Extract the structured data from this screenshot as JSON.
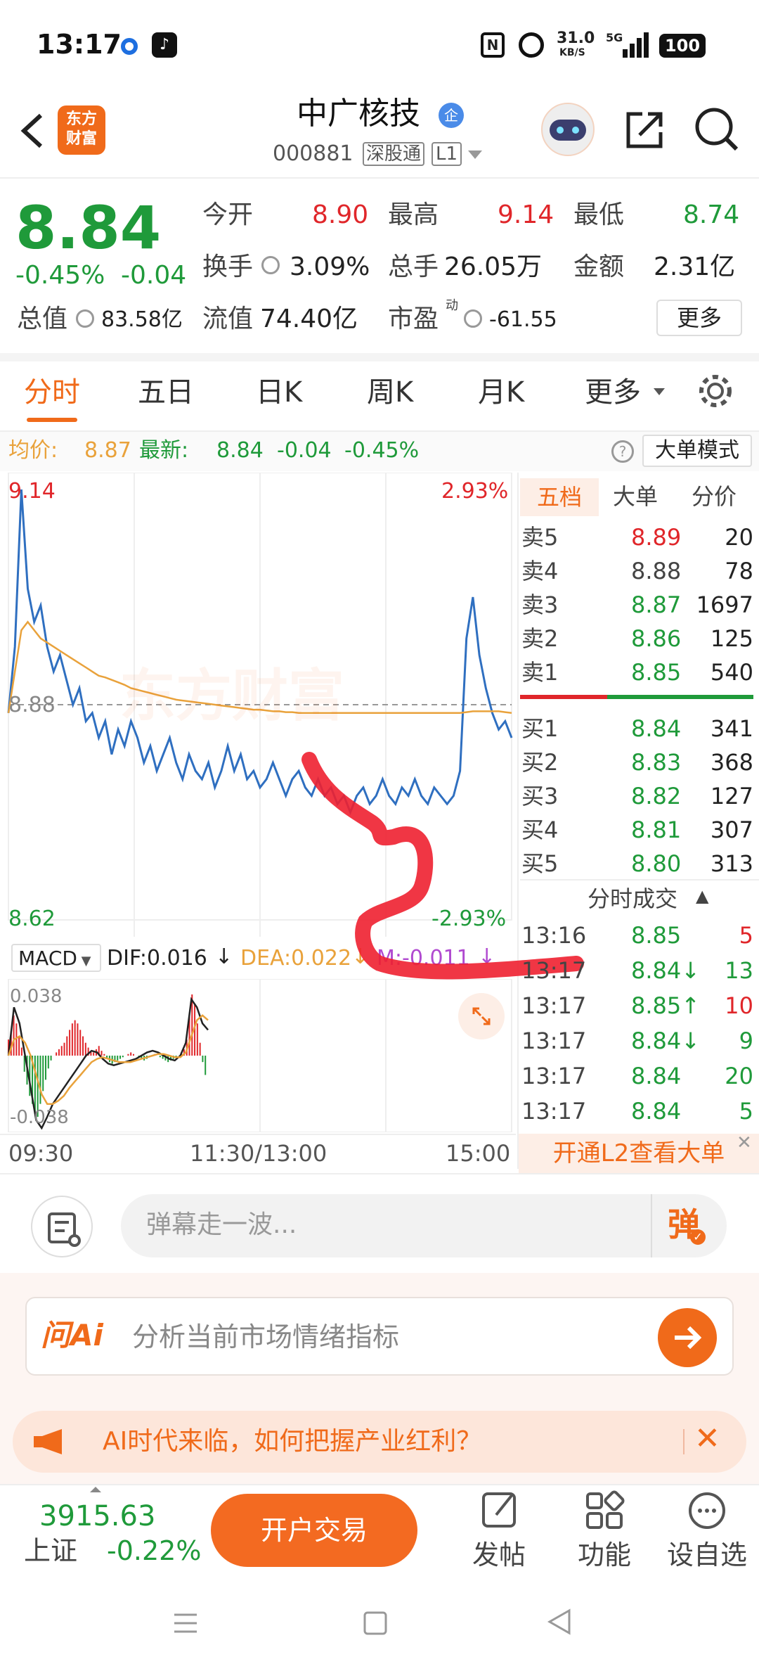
{
  "status_bar": {
    "time": "13:17",
    "speed_value": "31.0",
    "speed_unit": "KB/S",
    "signal": "5G",
    "battery": "100"
  },
  "header": {
    "logo_line1": "东方",
    "logo_line2": "财富",
    "name": "中广核技",
    "qi_badge": "企",
    "code": "000881",
    "market": "深股通",
    "level": "L1"
  },
  "quote": {
    "price": "8.84",
    "pct": "-0.45%",
    "change": "-0.04",
    "open_label": "今开",
    "open": "8.90",
    "high_label": "最高",
    "high": "9.14",
    "low_label": "最低",
    "low": "8.74",
    "turnover_label": "换手",
    "turnover": "3.09%",
    "volume_label": "总手",
    "volume": "26.05万",
    "amount_label": "金额",
    "amount": "2.31亿",
    "mktcap_label": "总值",
    "mktcap": "83.58亿",
    "float_label": "流值",
    "float": "74.40亿",
    "pe_label": "市盈",
    "pe_sup": "动",
    "pe": "-61.55",
    "more": "更多"
  },
  "tabs": {
    "t1": "分时",
    "t2": "五日",
    "t3": "日K",
    "t4": "周K",
    "t5": "月K",
    "t6": "更多"
  },
  "info_bar": {
    "avg_label": "均价:",
    "avg": "8.87",
    "latest_label": "最新:",
    "latest": "8.84",
    "chg": "-0.04",
    "pct": "-0.45%",
    "mode": "大单模式"
  },
  "chart_data": {
    "type": "line",
    "title": "",
    "y_top": "9.14",
    "y_mid": "8.88",
    "y_bot": "8.62",
    "pct_top": "2.93%",
    "pct_bot": "-2.93%",
    "watermark": "东方财富",
    "ylim": [
      8.62,
      9.14
    ],
    "series": [
      {
        "name": "price",
        "color": "#2f6fc0",
        "values": [
          8.87,
          8.95,
          9.14,
          9.02,
          8.98,
          9.0,
          8.95,
          8.92,
          8.94,
          8.91,
          8.88,
          8.9,
          8.86,
          8.87,
          8.84,
          8.86,
          8.82,
          8.85,
          8.83,
          8.86,
          8.84,
          8.81,
          8.83,
          8.8,
          8.82,
          8.84,
          8.81,
          8.79,
          8.82,
          8.8,
          8.79,
          8.81,
          8.78,
          8.8,
          8.83,
          8.8,
          8.82,
          8.79,
          8.8,
          8.78,
          8.79,
          8.81,
          8.79,
          8.77,
          8.79,
          8.8,
          8.78,
          8.77,
          8.79,
          8.77,
          8.78,
          8.76,
          8.77,
          8.75,
          8.77,
          8.78,
          8.76,
          8.77,
          8.79,
          8.77,
          8.76,
          8.78,
          8.77,
          8.79,
          8.77,
          8.76,
          8.78,
          8.77,
          8.76,
          8.77,
          8.8,
          8.96,
          9.01,
          8.94,
          8.9,
          8.87,
          8.85,
          8.86,
          8.84
        ]
      },
      {
        "name": "avg",
        "color": "#e9a23b",
        "values": [
          8.87,
          8.92,
          8.97,
          8.98,
          8.97,
          8.96,
          8.955,
          8.95,
          8.945,
          8.94,
          8.935,
          8.93,
          8.925,
          8.92,
          8.915,
          8.913,
          8.91,
          8.907,
          8.904,
          8.9,
          8.898,
          8.896,
          8.894,
          8.892,
          8.89,
          8.888,
          8.886,
          8.885,
          8.884,
          8.883,
          8.882,
          8.881,
          8.88,
          8.879,
          8.878,
          8.877,
          8.876,
          8.875,
          8.874,
          8.874,
          8.873,
          8.872,
          8.872,
          8.871,
          8.871,
          8.87,
          8.87,
          8.87,
          8.87,
          8.87,
          8.87,
          8.87,
          8.87,
          8.87,
          8.87,
          8.87,
          8.87,
          8.87,
          8.87,
          8.87,
          8.87,
          8.87,
          8.87,
          8.87,
          8.87,
          8.87,
          8.87,
          8.87,
          8.87,
          8.87,
          8.87,
          8.871,
          8.872,
          8.872,
          8.872,
          8.872,
          8.872,
          8.871,
          8.87
        ]
      }
    ],
    "x_ticks": [
      "09:30",
      "11:30/13:00",
      "15:00"
    ]
  },
  "macd": {
    "name": "MACD",
    "dif": "DIF:0.016",
    "dea": "DEA:0.022",
    "m": "M:-0.011",
    "y_top": "0.038",
    "y_bot": "-0.038",
    "bars": [
      0.01,
      0.015,
      0.025,
      0.02,
      0.012,
      0.005,
      -0.01,
      -0.018,
      -0.025,
      -0.03,
      -0.035,
      -0.038,
      -0.03,
      -0.022,
      -0.015,
      -0.008,
      -0.003,
      0.0,
      0.002,
      0.004,
      0.006,
      0.008,
      0.012,
      0.016,
      0.02,
      0.022,
      0.02,
      0.016,
      0.012,
      0.008,
      0.005,
      0.003,
      0.002,
      0.004,
      0.006,
      0.003,
      0.001,
      -0.002,
      -0.004,
      -0.005,
      -0.004,
      -0.003,
      -0.002,
      -0.001,
      0.0,
      0.001,
      0.002,
      0.001,
      0.0,
      -0.001,
      -0.002,
      -0.003,
      -0.002,
      -0.001,
      0.0,
      0.001,
      0.0,
      -0.001,
      -0.002,
      -0.003,
      -0.004,
      -0.003,
      -0.002,
      -0.001,
      0.0,
      0.002,
      0.004,
      0.01,
      0.025,
      0.038,
      0.032,
      0.02,
      0.008,
      -0.004,
      -0.012
    ],
    "dif_values": [
      0.0,
      0.03,
      0.02,
      0.0,
      -0.02,
      -0.04,
      -0.045,
      -0.038,
      -0.03,
      -0.025,
      -0.02,
      -0.015,
      -0.01,
      -0.005,
      0.0,
      0.003,
      0.002,
      -0.002,
      -0.005,
      -0.006,
      -0.005,
      -0.004,
      -0.003,
      -0.002,
      0.0,
      0.002,
      0.003,
      0.002,
      0.0,
      -0.002,
      -0.003,
      0.0,
      0.008,
      0.035,
      0.03,
      0.02,
      0.016
    ],
    "dea_values": [
      0.0,
      0.01,
      0.012,
      0.008,
      0.0,
      -0.012,
      -0.024,
      -0.03,
      -0.03,
      -0.028,
      -0.025,
      -0.02,
      -0.016,
      -0.012,
      -0.008,
      -0.004,
      -0.002,
      -0.001,
      -0.002,
      -0.003,
      -0.004,
      -0.004,
      -0.004,
      -0.003,
      -0.002,
      -0.001,
      0.0,
      0.001,
      0.001,
      0.0,
      -0.001,
      -0.001,
      0.002,
      0.012,
      0.022,
      0.025,
      0.022
    ]
  },
  "book": {
    "tabs": [
      "五档",
      "大单",
      "分价"
    ],
    "asks": [
      {
        "l": "卖5",
        "p": "8.89",
        "v": "20",
        "c": "red"
      },
      {
        "l": "卖4",
        "p": "8.88",
        "v": "78",
        "c": "gray"
      },
      {
        "l": "卖3",
        "p": "8.87",
        "v": "1697",
        "c": "green"
      },
      {
        "l": "卖2",
        "p": "8.86",
        "v": "125",
        "c": "green"
      },
      {
        "l": "卖1",
        "p": "8.85",
        "v": "540",
        "c": "green"
      }
    ],
    "bids": [
      {
        "l": "买1",
        "p": "8.84",
        "v": "341",
        "c": "green"
      },
      {
        "l": "买2",
        "p": "8.83",
        "v": "368",
        "c": "green"
      },
      {
        "l": "买3",
        "p": "8.82",
        "v": "127",
        "c": "green"
      },
      {
        "l": "买4",
        "p": "8.81",
        "v": "307",
        "c": "green"
      },
      {
        "l": "买5",
        "p": "8.80",
        "v": "313",
        "c": "green"
      }
    ],
    "ticks_title": "分时成交",
    "ticks": [
      {
        "t": "13:16",
        "p": "8.85",
        "v": "5",
        "pc": "green",
        "vc": "red"
      },
      {
        "t": "13:17",
        "p": "8.84↓",
        "v": "13",
        "pc": "green",
        "vc": "green"
      },
      {
        "t": "13:17",
        "p": "8.85↑",
        "v": "10",
        "pc": "green",
        "vc": "red"
      },
      {
        "t": "13:17",
        "p": "8.84↓",
        "v": "9",
        "pc": "green",
        "vc": "green"
      },
      {
        "t": "13:17",
        "p": "8.84",
        "v": "20",
        "pc": "green",
        "vc": "green"
      },
      {
        "t": "13:17",
        "p": "8.84",
        "v": "5",
        "pc": "green",
        "vc": "green"
      }
    ],
    "l2_banner": "开通L2查看大单"
  },
  "comment": {
    "placeholder": "弹幕走一波...",
    "danmu": "弹"
  },
  "ai": {
    "logo": "问Ai",
    "prompt": "分析当前市场情绪指标"
  },
  "notice": {
    "text": "AI时代来临，如何把握产业红利？"
  },
  "bottom": {
    "index_value": "3915.63",
    "index_name": "上证",
    "index_pct": "-0.22%",
    "trade": "开户交易",
    "post": "发帖",
    "func": "功能",
    "watch": "设自选"
  },
  "colors": {
    "accent": "#f06a1a",
    "up": "#e0262a",
    "down": "#1f9a3a"
  }
}
